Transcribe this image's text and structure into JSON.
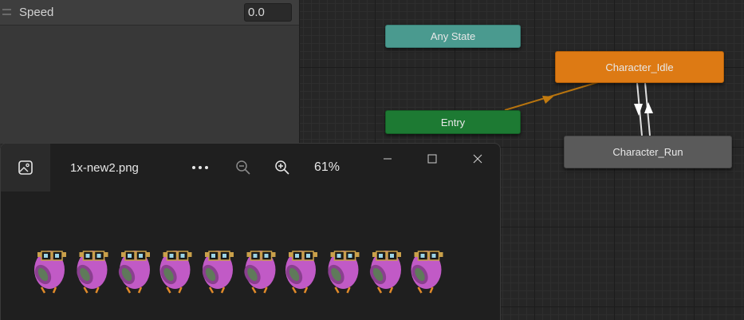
{
  "parameters": {
    "items": [
      {
        "name": "Speed",
        "value": "0.0"
      }
    ]
  },
  "graph": {
    "nodes": {
      "any_state": "Any State",
      "entry": "Entry",
      "idle": "Character_Idle",
      "run": "Character_Run"
    },
    "colors": {
      "any_state": "#4a9a8f",
      "entry": "#1d7a33",
      "default_state": "#dd7a14",
      "state": "#5a5a5a",
      "default_transition": "#b8740e"
    }
  },
  "viewer": {
    "file_name": "1x-new2.png",
    "zoom": "61%",
    "icons": {
      "app": "image-icon",
      "more": "ellipsis-icon",
      "zoom_out": "zoom-out-icon",
      "zoom_in": "zoom-in-icon",
      "minimize": "minimize-icon",
      "maximize": "maximize-icon",
      "close": "close-icon"
    },
    "sprite": {
      "frame_count": 10,
      "body_color": "#c15ac6",
      "goggle_color": "#c9a04a"
    }
  }
}
